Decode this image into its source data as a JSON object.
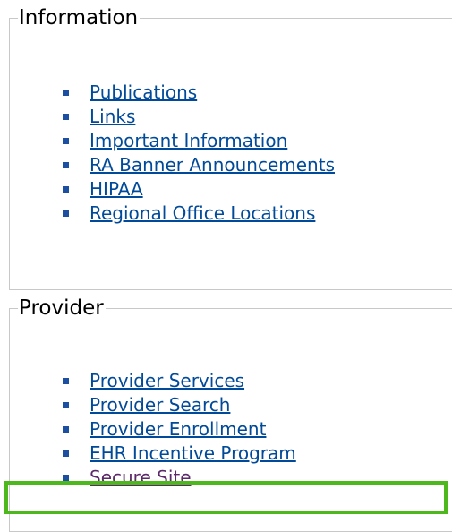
{
  "information": {
    "legend": "Information",
    "links": [
      {
        "label": "Publications"
      },
      {
        "label": "Links"
      },
      {
        "label": "Important Information"
      },
      {
        "label": "RA Banner Announcements"
      },
      {
        "label": "HIPAA"
      },
      {
        "label": "Regional Office Locations"
      }
    ]
  },
  "provider": {
    "legend": "Provider",
    "links": [
      {
        "label": "Provider Services"
      },
      {
        "label": "Provider Search"
      },
      {
        "label": "Provider Enrollment"
      },
      {
        "label": "EHR Incentive Program"
      },
      {
        "label": "Secure Site"
      }
    ]
  },
  "colors": {
    "link": "#004a99",
    "visited_link": "#5c2a6a",
    "bullet": "#1d4fa0",
    "highlight_border": "#4cb81c",
    "panel_border": "#c8c8c8"
  }
}
